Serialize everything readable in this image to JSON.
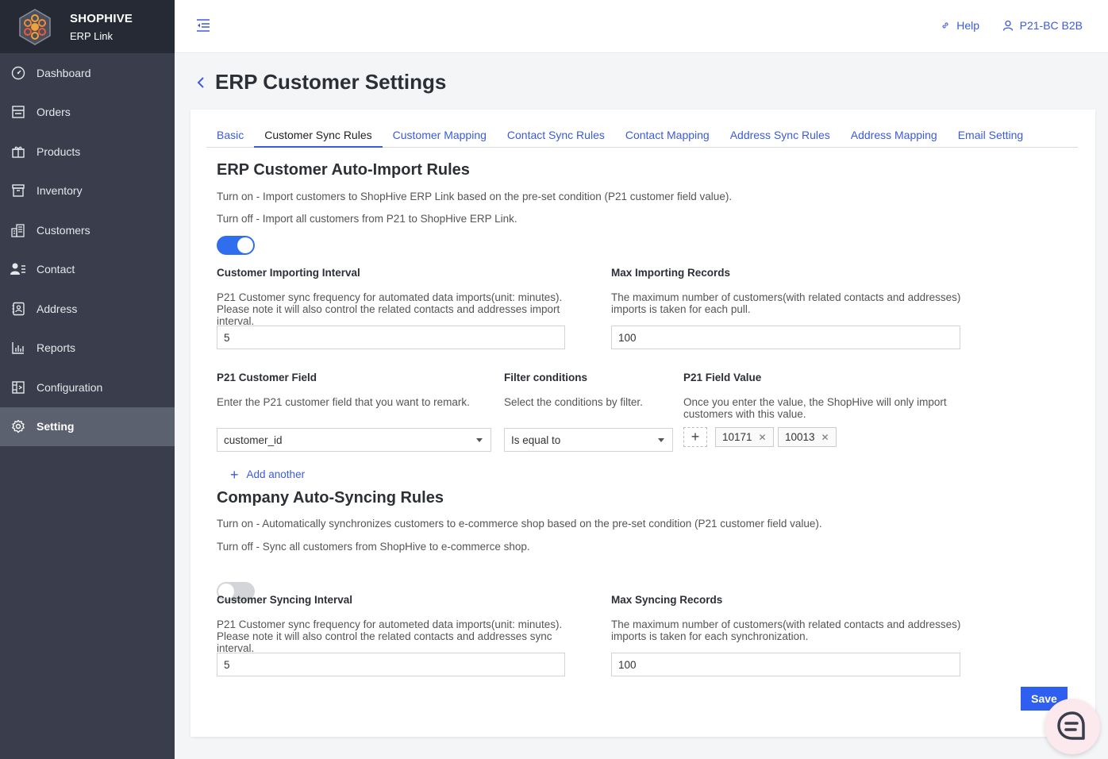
{
  "brand": {
    "name": "SHOPHIVE",
    "subtitle": "ERP Link"
  },
  "sidebar": {
    "items": [
      {
        "label": "Dashboard",
        "icon": "dashboard-gauge-icon"
      },
      {
        "label": "Orders",
        "icon": "orders-icon"
      },
      {
        "label": "Products",
        "icon": "gift-box-icon"
      },
      {
        "label": "Inventory",
        "icon": "inventory-box-icon"
      },
      {
        "label": "Customers",
        "icon": "buildings-icon"
      },
      {
        "label": "Contact",
        "icon": "contact-person-icon"
      },
      {
        "label": "Address",
        "icon": "address-book-icon"
      },
      {
        "label": "Reports",
        "icon": "bar-chart-icon"
      },
      {
        "label": "Configuration",
        "icon": "configuration-icon"
      },
      {
        "label": "Setting",
        "icon": "gear-icon",
        "active": true
      }
    ]
  },
  "header": {
    "help": "Help",
    "user": "P21-BC B2B"
  },
  "page": {
    "title": "ERP Customer Settings"
  },
  "tabs": [
    "Basic",
    "Customer Sync Rules",
    "Customer Mapping",
    "Contact Sync Rules",
    "Contact Mapping",
    "Address Sync Rules",
    "Address Mapping",
    "Email Setting"
  ],
  "active_tab": "Customer Sync Rules",
  "import_section": {
    "title": "ERP Customer Auto-Import Rules",
    "desc_on": "Turn on - Import customers to ShopHive ERP Link based on the pre-set condition (P21 customer field value).",
    "desc_off": "Turn off - Import all customers from P21 to ShopHive ERP Link.",
    "toggle_on": true,
    "interval_label": "Customer Importing Interval",
    "interval_help": "P21 Customer sync frequency for automated data imports(unit: minutes). Please note it will also control the related contacts and addresses import interval.",
    "interval_value": "5",
    "max_label": "Max Importing Records",
    "max_help": "The maximum number of customers(with related contacts and addresses) imports is taken for each pull.",
    "max_value": "100",
    "field_label": "P21 Customer Field",
    "field_help": "Enter the P21 customer field that you want to remark.",
    "field_value": "customer_id",
    "filter_label": "Filter conditions",
    "filter_help": "Select the conditions by filter.",
    "filter_value": "Is equal to",
    "value_label": "P21 Field Value",
    "value_help": "Once you enter the value, the ShopHive will only import customers with this value.",
    "tags": [
      "10171",
      "10013"
    ],
    "add_another": "Add another"
  },
  "sync_section": {
    "title": "Company Auto-Syncing Rules",
    "desc_on": "Turn on - Automatically synchronizes customers to e-commerce shop based on the pre-set condition (P21 customer field value).",
    "desc_off": "Turn off - Sync all customers from ShopHive to e-commerce shop.",
    "toggle_on": false,
    "interval_label": "Customer Syncing Interval",
    "interval_help": "P21 Customer sync frequency for autometed data imports(unit: minutes). Please note it will also control the related contacts and addresses sync interval.",
    "interval_value": "5",
    "max_label": "Max Syncing Records",
    "max_help": "The maximum number of customers(with related contacts and addresses) imports is taken for each synchronization.",
    "max_value": "100"
  },
  "save_label": "Save",
  "colors": {
    "accent": "#2f6fed",
    "sidebar": "#3a3e4c",
    "brand_bar": "#262a35",
    "link": "#3b5bdb"
  }
}
